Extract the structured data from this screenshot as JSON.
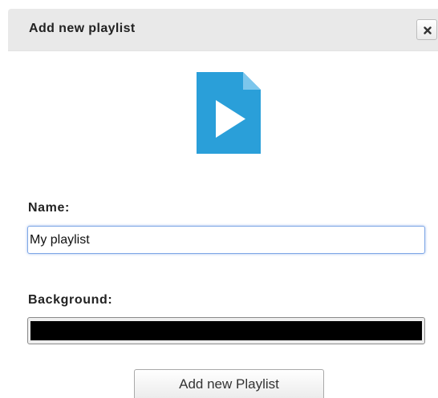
{
  "dialog": {
    "title": "Add new playlist",
    "close_icon": "close-icon"
  },
  "icon": {
    "name": "playlist-file-icon",
    "color": "#2a9fd9"
  },
  "form": {
    "name_label": "Name:",
    "name_value": "My playlist",
    "background_label": "Background:",
    "background_color": "#000000"
  },
  "actions": {
    "submit_label": "Add new Playlist"
  }
}
